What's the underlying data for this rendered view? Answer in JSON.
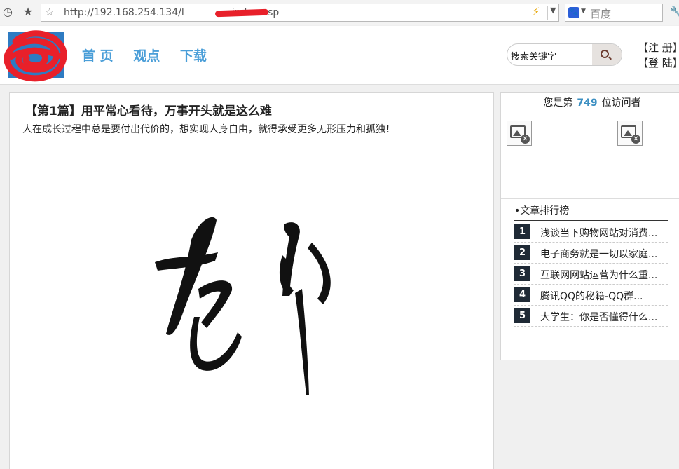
{
  "browser": {
    "url": "http://192.168.254.134/l",
    "url_tail": "index.asp",
    "search_engine_label": "百度"
  },
  "site": {
    "nav": [
      "首 页",
      "观点",
      "下载"
    ],
    "search_placeholder": "搜索关键字",
    "register": "【注 册】",
    "login": "【登 陆】"
  },
  "article": {
    "title": "【第1篇】用平常心看待，万事开头就是这么难",
    "subtitle": "人在成长过程中总是要付出代价的，想实现人身自由，就得承受更多无形压力和孤独！"
  },
  "sidebar": {
    "visitor_prefix": "您是第",
    "visitor_count": "749",
    "visitor_suffix": "位访问者",
    "ranking_title": "•文章排行榜",
    "ranking": [
      {
        "num": "1",
        "title": "浅谈当下购物网站对消费..."
      },
      {
        "num": "2",
        "title": "电子商务就是一切以家庭..."
      },
      {
        "num": "3",
        "title": "互联网网站运营为什么重..."
      },
      {
        "num": "4",
        "title": "腾讯QQ的秘籍-QQ群..."
      },
      {
        "num": "5",
        "title": "大学生：你是否懂得什么..."
      }
    ]
  },
  "colors": {
    "nav": "#4a9ed8",
    "logo": "#2e7bc2",
    "visitor_count": "#3b8fc2",
    "rank_badge": "#1f2a36"
  }
}
